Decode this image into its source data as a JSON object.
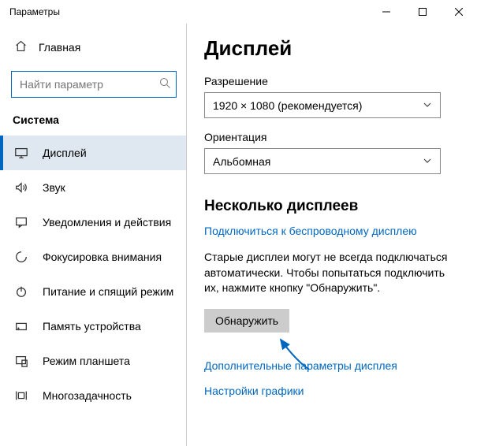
{
  "window": {
    "title": "Параметры"
  },
  "sidebar": {
    "home": "Главная",
    "search_placeholder": "Найти параметр",
    "section": "Система",
    "items": [
      {
        "label": "Дисплей"
      },
      {
        "label": "Звук"
      },
      {
        "label": "Уведомления и действия"
      },
      {
        "label": "Фокусировка внимания"
      },
      {
        "label": "Питание и спящий режим"
      },
      {
        "label": "Память устройства"
      },
      {
        "label": "Режим планшета"
      },
      {
        "label": "Многозадачность"
      }
    ]
  },
  "main": {
    "title": "Дисплей",
    "resolution_label": "Разрешение",
    "resolution_value": "1920 × 1080 (рекомендуется)",
    "orientation_label": "Ориентация",
    "orientation_value": "Альбомная",
    "multi_title": "Несколько дисплеев",
    "connect_link": "Подключиться к беспроводному дисплею",
    "detect_info": "Старые дисплеи могут не всегда подключаться автоматически. Чтобы попытаться подключить их, нажмите кнопку \"Обнаружить\".",
    "detect_btn": "Обнаружить",
    "advanced_link": "Дополнительные параметры дисплея",
    "graphics_link": "Настройки графики"
  }
}
